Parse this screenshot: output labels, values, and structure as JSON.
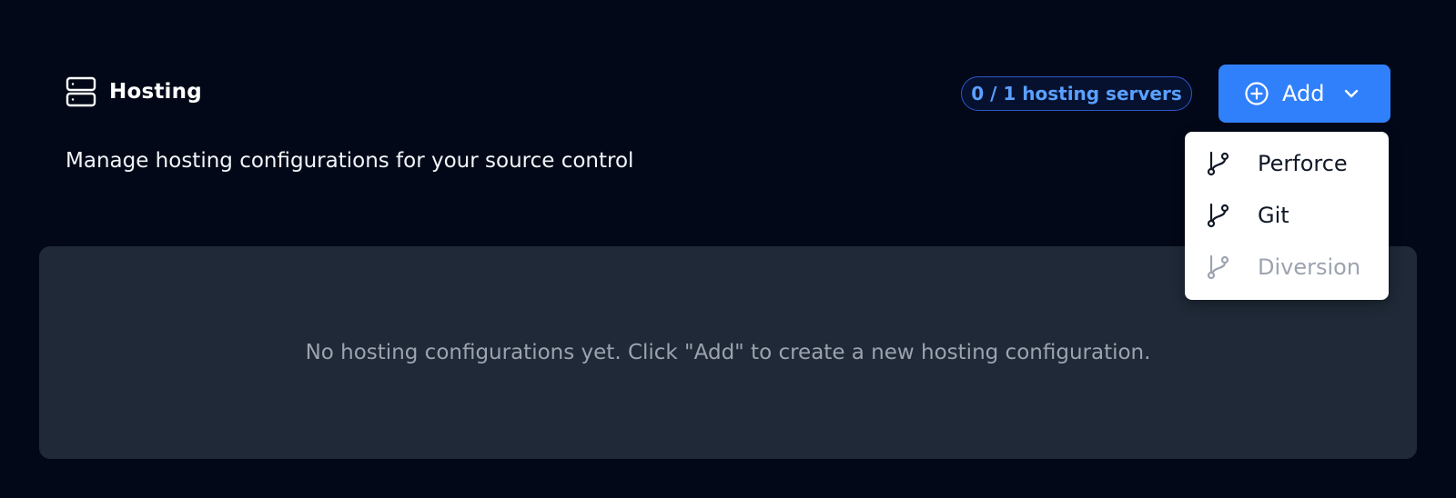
{
  "header": {
    "icon": "server-icon",
    "title": "Hosting"
  },
  "subtitle": "Manage hosting configurations for your source control",
  "badge": {
    "text": "0 / 1 hosting servers",
    "color": "#5aa0ff"
  },
  "add_button": {
    "label": "Add",
    "icon": "plus-circle-icon",
    "chevron": "chevron-down-icon",
    "color": "#3080fb"
  },
  "dropdown": {
    "items": [
      {
        "label": "Perforce",
        "icon": "git-branch-icon",
        "disabled": false
      },
      {
        "label": "Git",
        "icon": "git-branch-icon",
        "disabled": false
      },
      {
        "label": "Diversion",
        "icon": "git-branch-icon",
        "disabled": true
      }
    ]
  },
  "empty_state": {
    "text": "No hosting configurations yet. Click \"Add\" to create a new hosting configuration."
  },
  "colors": {
    "background": "#020817",
    "panel": "#1f2937",
    "accent": "#3080fb"
  }
}
